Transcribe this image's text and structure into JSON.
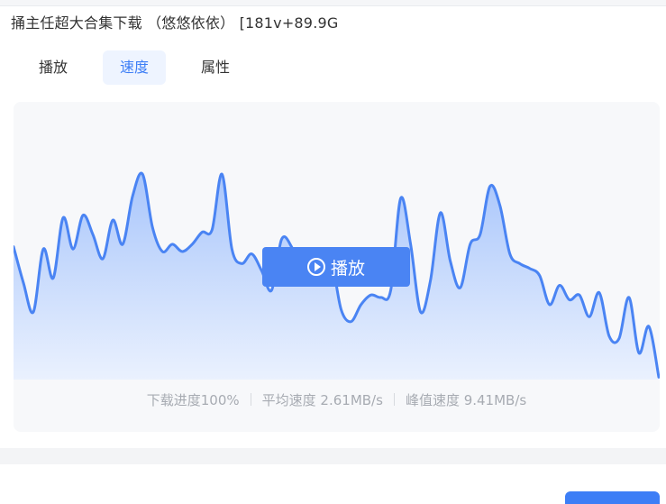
{
  "title": "捅主任超大合集下载 （悠悠依依） [181v+89.9G",
  "tabs": [
    {
      "label": "播放",
      "active": false
    },
    {
      "label": "速度",
      "active": true
    },
    {
      "label": "属性",
      "active": false
    }
  ],
  "play_button": {
    "label": "播放",
    "icon": "play-circle-icon"
  },
  "stats": {
    "progress": "下载进度100%",
    "avg_speed": "平均速度 2.61MB/s",
    "peak_speed": "峰值速度 9.41MB/s"
  },
  "colors": {
    "accent": "#3d7ef6",
    "line": "#4a84f3",
    "fill_top": "#a9c6fb",
    "fill_bottom": "#eaf1fe"
  },
  "chart_data": {
    "type": "area",
    "title": "",
    "xlabel": "",
    "ylabel": "",
    "grid": false,
    "series": [
      {
        "values": [
          5.5,
          4.0,
          2.8,
          5.4,
          4.2,
          6.7,
          5.4,
          6.8,
          6.0,
          5.0,
          6.6,
          5.6,
          7.6,
          8.5,
          6.3,
          5.3,
          5.6,
          5.3,
          5.6,
          6.1,
          6.2,
          8.5,
          5.4,
          4.8,
          5.2,
          4.5,
          3.7,
          5.8,
          5.5,
          4.4,
          4.6,
          5.3,
          5.0,
          2.9,
          2.4,
          3.1,
          3.5,
          3.4,
          3.7,
          7.5,
          5.6,
          2.8,
          4.1,
          6.9,
          4.9,
          3.8,
          5.6,
          6.0,
          8.0,
          7.2,
          5.2,
          4.8,
          4.6,
          4.3,
          3.1,
          3.9,
          3.3,
          3.5,
          2.6,
          3.6,
          1.8,
          1.7,
          3.4,
          1.1,
          2.2,
          0.1
        ]
      }
    ],
    "ylim": [
      0,
      10
    ]
  }
}
